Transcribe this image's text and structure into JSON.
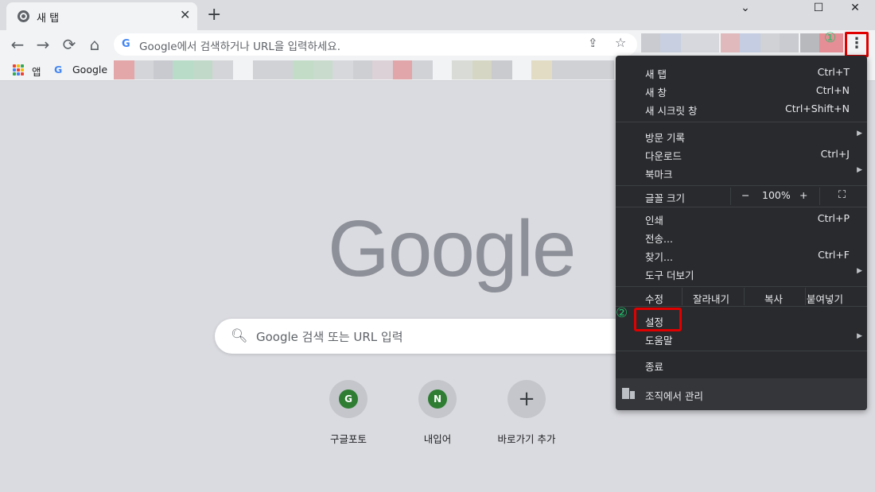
{
  "tab": {
    "title": "새 탭"
  },
  "window_controls": {
    "minimize": "⌄",
    "maximize": "☐",
    "close": "✕"
  },
  "omnibox": {
    "placeholder": "Google에서 검색하거나 URL을 입력하세요."
  },
  "annotations": {
    "step1": "①",
    "step2": "②"
  },
  "bookmarks": {
    "apps_label": "앱",
    "google_label": "Google"
  },
  "ntp": {
    "logo": "Google",
    "search_placeholder": "Google 검색 또는 URL 입력",
    "shortcuts": [
      {
        "initial": "G",
        "label": "구글포토"
      },
      {
        "initial": "N",
        "label": "내입어"
      },
      {
        "label": "바로가기 추가"
      }
    ]
  },
  "menu": {
    "new_tab": {
      "label": "새 탭",
      "shortcut": "Ctrl+T"
    },
    "new_window": {
      "label": "새 창",
      "shortcut": "Ctrl+N"
    },
    "incognito": {
      "label": "새 시크릿 창",
      "shortcut": "Ctrl+Shift+N"
    },
    "history": {
      "label": "방문 기록"
    },
    "downloads": {
      "label": "다운로드",
      "shortcut": "Ctrl+J"
    },
    "bookmarks": {
      "label": "북마크"
    },
    "zoom": {
      "label": "글꼴 크기",
      "minus": "−",
      "value": "100%",
      "plus": "+"
    },
    "print": {
      "label": "인쇄",
      "shortcut": "Ctrl+P"
    },
    "cast": {
      "label": "전송..."
    },
    "find": {
      "label": "찾기...",
      "shortcut": "Ctrl+F"
    },
    "more_tools": {
      "label": "도구 더보기"
    },
    "edit": {
      "label": "수정",
      "cut": "잘라내기",
      "copy": "복사",
      "paste": "붙여넣기"
    },
    "settings": {
      "label": "설정"
    },
    "help": {
      "label": "도움말"
    },
    "exit": {
      "label": "종료"
    },
    "managed": {
      "label": "조직에서 관리"
    }
  }
}
